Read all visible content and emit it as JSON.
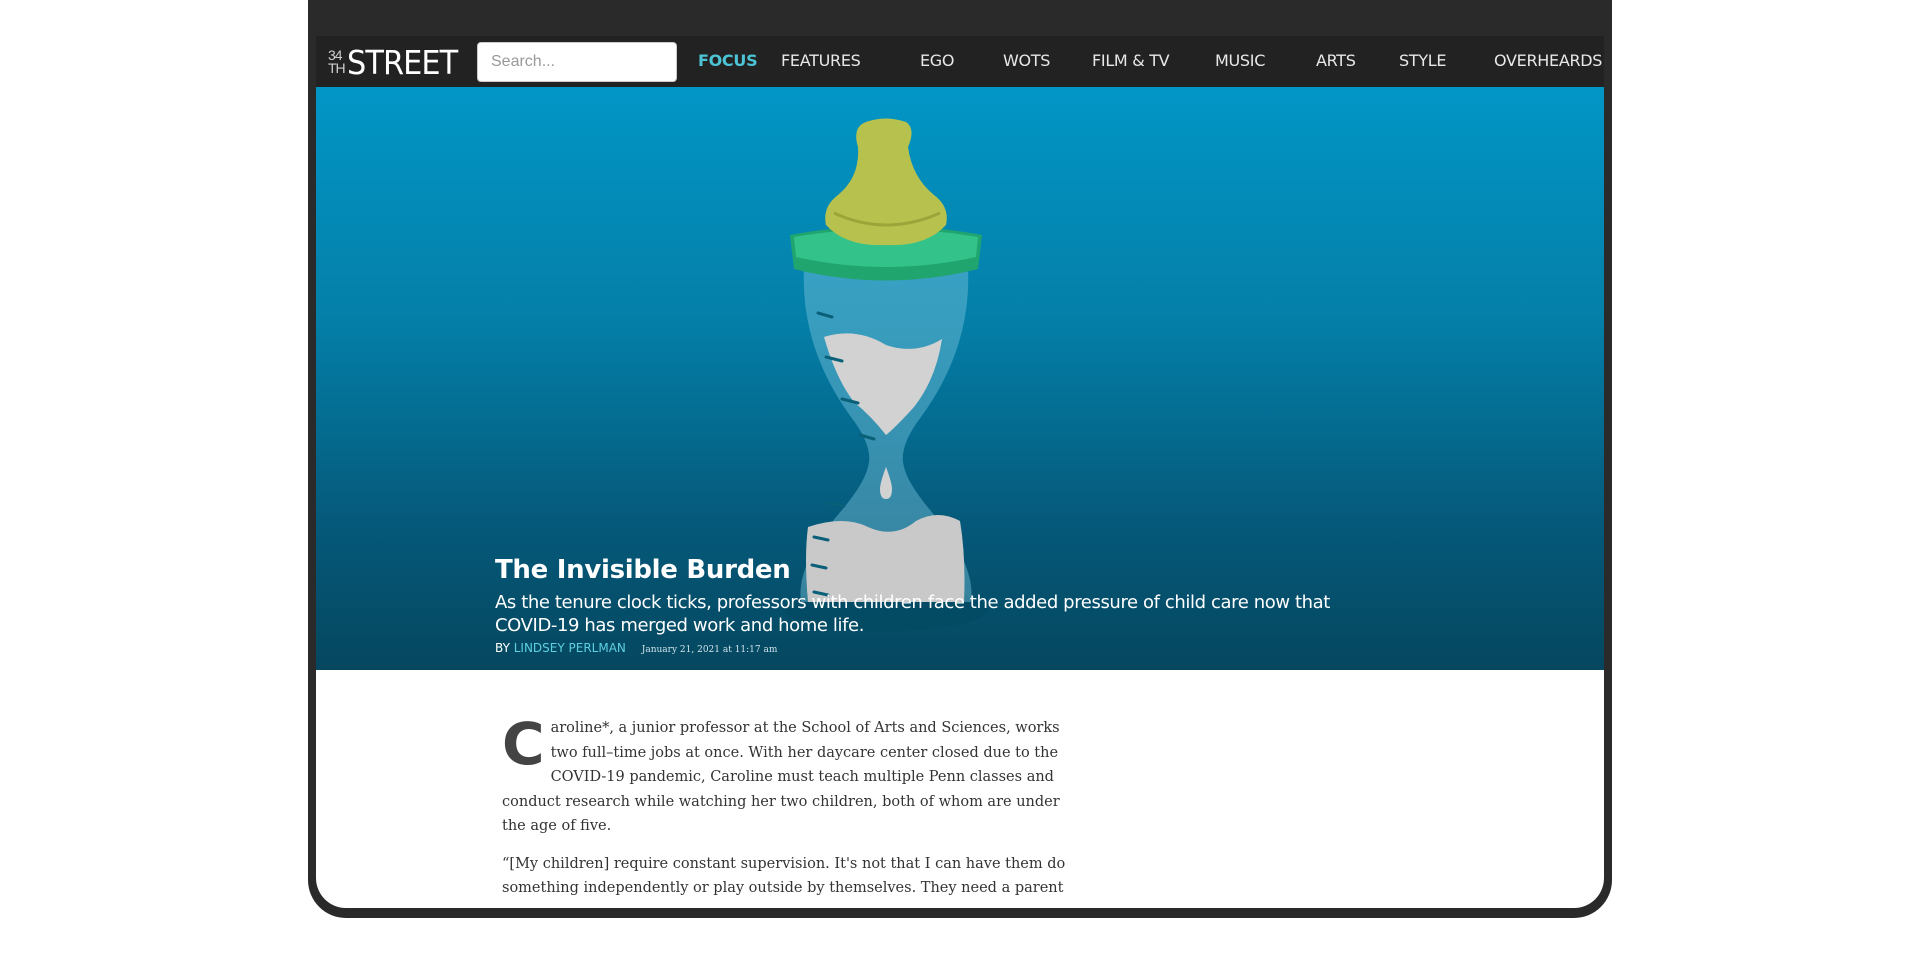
{
  "nav": {
    "logo_number": [
      "34",
      "TH"
    ],
    "logo_word": "STREET",
    "search_placeholder": "Search...",
    "items": [
      {
        "label": "FOCUS",
        "active": true
      },
      {
        "label": "FEATURES"
      },
      {
        "label": "EGO"
      },
      {
        "label": "WOTS"
      },
      {
        "label": "FILM & TV"
      },
      {
        "label": "MUSIC"
      },
      {
        "label": "ARTS"
      },
      {
        "label": "STYLE"
      },
      {
        "label": "OVERHEARDS"
      }
    ]
  },
  "hero": {
    "title": "The Invisible Burden",
    "subtitle": "As the tenure clock ticks, professors with children face the added pressure of child care now that COVID-19 has merged work and home life.",
    "byline_prefix": "BY",
    "author": "LINDSEY PERLMAN",
    "date": "January 21, 2021 at 11:17 am",
    "image_icon": "baby-bottle-hourglass-illustration"
  },
  "article": {
    "drop_cap": "C",
    "paragraphs": [
      "aroline*, a junior professor at the School of Arts and Sciences, works two full–time jobs at once. With her daycare center closed due to the COVID-19 pandemic, Caroline must teach multiple Penn classes and conduct research while watching her two children, both of whom are under the age of five.",
      "“[My children] require constant supervision. It's not that I can have them do something independently or play outside by themselves. They need a parent—or"
    ]
  },
  "colors": {
    "nav_bg": "#222222",
    "accent": "#4cc4d6",
    "hero_top": "#0296c6",
    "hero_bottom": "#05475f",
    "frame": "#2a2a2a"
  }
}
